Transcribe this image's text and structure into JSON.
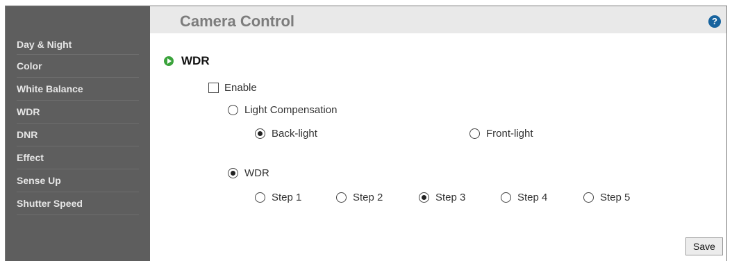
{
  "header": {
    "title": "Camera Control",
    "help_glyph": "?"
  },
  "sidebar": {
    "items": [
      {
        "label": "Day & Night"
      },
      {
        "label": "Color"
      },
      {
        "label": "White Balance"
      },
      {
        "label": "WDR"
      },
      {
        "label": "DNR"
      },
      {
        "label": "Effect"
      },
      {
        "label": "Sense Up"
      },
      {
        "label": "Shutter Speed"
      }
    ]
  },
  "section": {
    "title": "WDR",
    "bullet_icon": "play-circle-icon",
    "bullet_color": "#3ba33c"
  },
  "form": {
    "enable": {
      "label": "Enable",
      "checked": false
    },
    "light_compensation": {
      "label": "Light Compensation",
      "selected": false
    },
    "back_light": {
      "label": "Back-light",
      "selected": true
    },
    "front_light": {
      "label": "Front-light",
      "selected": false
    },
    "wdr": {
      "label": "WDR",
      "selected": true
    },
    "steps": [
      {
        "label": "Step 1",
        "selected": false
      },
      {
        "label": "Step 2",
        "selected": false
      },
      {
        "label": "Step 3",
        "selected": true
      },
      {
        "label": "Step 4",
        "selected": false
      },
      {
        "label": "Step 5",
        "selected": false
      }
    ]
  },
  "actions": {
    "save_label": "Save"
  }
}
